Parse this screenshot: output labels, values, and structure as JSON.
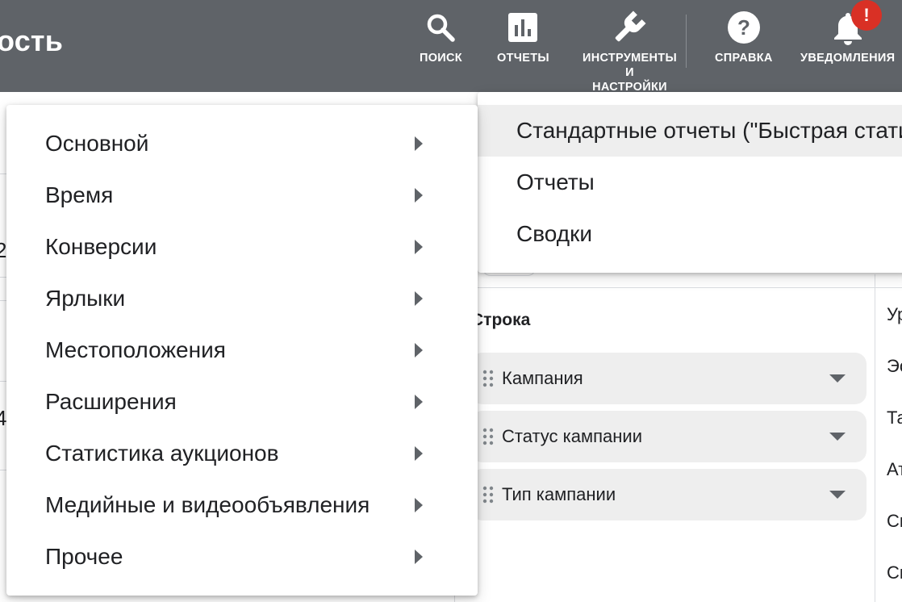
{
  "header": {
    "page_title": "ость",
    "tools": {
      "search": "ПОИСК",
      "reports": "ОТЧЕТЫ",
      "tools_settings_1": "ИНСТРУМЕНТЫ",
      "tools_settings_2": "И",
      "tools_settings_3": "НАСТРОЙКИ",
      "help": "СПРАВКА",
      "notifications": "УВЕДОМЛЕНИЯ"
    },
    "notification_badge": "!"
  },
  "menu_left": {
    "items": [
      {
        "label": "Основной"
      },
      {
        "label": "Время"
      },
      {
        "label": "Конверсии"
      },
      {
        "label": "Ярлыки"
      },
      {
        "label": "Местоположения"
      },
      {
        "label": "Расширения"
      },
      {
        "label": "Статистика аукционов"
      },
      {
        "label": "Медийные и видеообъявления"
      },
      {
        "label": "Прочее"
      }
    ]
  },
  "menu_right": {
    "items": [
      {
        "label": "Стандартные отчеты (\"Быстрая статистика\")"
      },
      {
        "label": "Отчеты"
      },
      {
        "label": "Сводки"
      }
    ]
  },
  "background": {
    "left_fragments": [
      "2",
      "4"
    ],
    "row_heading": "Строка",
    "chips": [
      {
        "label": "Кампания"
      },
      {
        "label": "Статус кампании"
      },
      {
        "label": "Тип кампании"
      }
    ],
    "right_column": [
      "Ур",
      "Эс",
      "Та",
      "Ат",
      "Сп",
      "Сп"
    ]
  },
  "colors": {
    "topbar": "#5f6368",
    "badge": "#d93025",
    "highlight": "#eeeeee"
  }
}
